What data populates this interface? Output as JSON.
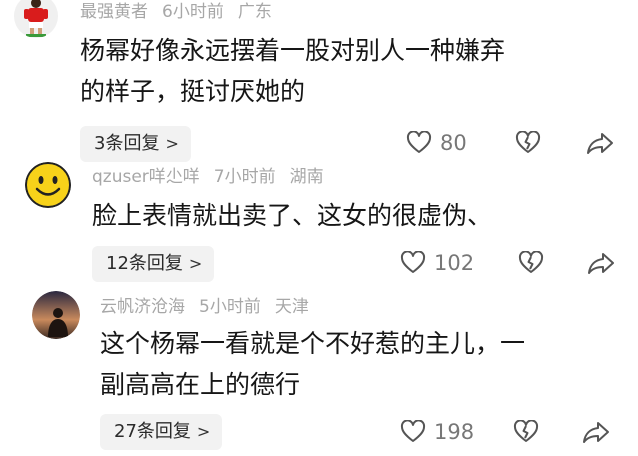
{
  "comments": [
    {
      "username": "最强黄者",
      "time": "6小时前",
      "location": "广东",
      "text_lines": [
        "杨幂好像永远摆着一股对别人一种嫌弃",
        "的样子，挺讨厌她的"
      ],
      "reply_label": "3条回复",
      "likes": "80",
      "avatar_icon": "soccer-player-icon"
    },
    {
      "username": "qzuser咩尐咩",
      "time": "7小时前",
      "location": "湖南",
      "text_lines": [
        "脸上表情就出卖了、这女的很虚伪、"
      ],
      "reply_label": "12条回复",
      "likes": "102",
      "avatar_icon": "smiley-face-icon"
    },
    {
      "username": "云帆济沧海",
      "time": "5小时前",
      "location": "天津",
      "text_lines": [
        "这个杨幂一看就是个不好惹的主儿，一",
        "副高高在上的德行"
      ],
      "reply_label": "27条回复",
      "likes": "198",
      "avatar_icon": "silhouette-photo-icon"
    }
  ],
  "icons": {
    "like": "heart-icon",
    "dislike": "broken-heart-icon",
    "share": "share-arrow-icon",
    "reply_chevron": "chevron-right-icon"
  },
  "colors": {
    "meta_text": "#a7a7a7",
    "reply_bg": "#f2f2f2",
    "icon_stroke": "#555555"
  }
}
